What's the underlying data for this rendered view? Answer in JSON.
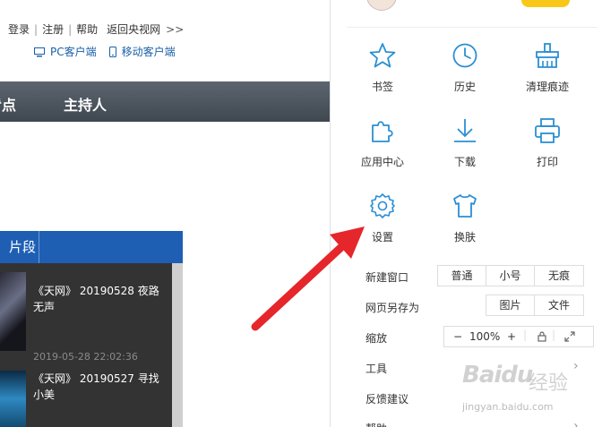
{
  "topbar": {
    "links": [
      "登录",
      "注册",
      "帮助",
      "返回央视网"
    ],
    "more": ">>",
    "pc_client": "PC客户端",
    "mobile_client": "移动客户端"
  },
  "navbar": {
    "items": [
      "看点",
      "主持人"
    ]
  },
  "videos": {
    "tab_label": "片段",
    "items": [
      {
        "title": "《天网》 20190528 夜路无声",
        "time": "2019-05-28 22:02:36"
      },
      {
        "title": "《天网》 20190527 寻找小美",
        "time": ""
      }
    ]
  },
  "menu": {
    "grid": [
      {
        "label": "书签",
        "icon": "star-icon"
      },
      {
        "label": "历史",
        "icon": "clock-icon"
      },
      {
        "label": "清理痕迹",
        "icon": "broom-icon"
      },
      {
        "label": "应用中心",
        "icon": "puzzle-icon"
      },
      {
        "label": "下载",
        "icon": "download-icon"
      },
      {
        "label": "打印",
        "icon": "printer-icon"
      },
      {
        "label": "设置",
        "icon": "gear-icon"
      },
      {
        "label": "换肤",
        "icon": "shirt-icon"
      }
    ],
    "new_window": {
      "label": "新建窗口",
      "options": [
        "普通",
        "小号",
        "无痕"
      ]
    },
    "save_as": {
      "label": "网页另存为",
      "options": [
        "图片",
        "文件"
      ]
    },
    "zoom": {
      "label": "缩放",
      "minus": "−",
      "value": "100%",
      "plus": "+"
    },
    "tools": "工具",
    "feedback": "反馈建议",
    "help": "帮助"
  },
  "watermark": {
    "brand": "Baidu",
    "cn": "经验",
    "url": "jingyan.baidu.com"
  },
  "colors": {
    "accent": "#2a8fd4",
    "nav_bg": "#4a525a",
    "tab_blue": "#1e5fb4",
    "pointer_red": "#e5262b",
    "badge_yellow": "#f9c717"
  }
}
